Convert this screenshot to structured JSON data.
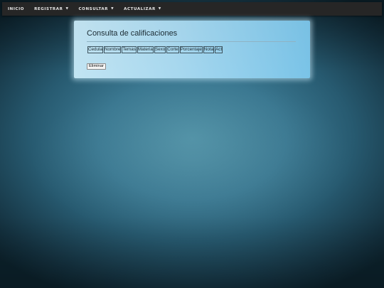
{
  "nav": {
    "items": [
      {
        "label": "INICIO",
        "has_dropdown": false
      },
      {
        "label": "REGISTRAR",
        "has_dropdown": true
      },
      {
        "label": "CONSULTAR",
        "has_dropdown": true
      },
      {
        "label": "ACTUALIZAR",
        "has_dropdown": true
      }
    ]
  },
  "card": {
    "title": "Consulta de calificaciones",
    "table": {
      "columns": [
        "Cedula",
        "Nombre",
        "Temas",
        "Materia",
        "Sexo",
        "Corte",
        "Porcentaje",
        "Nota",
        "Act"
      ]
    },
    "delete_label": "Eliminar"
  }
}
